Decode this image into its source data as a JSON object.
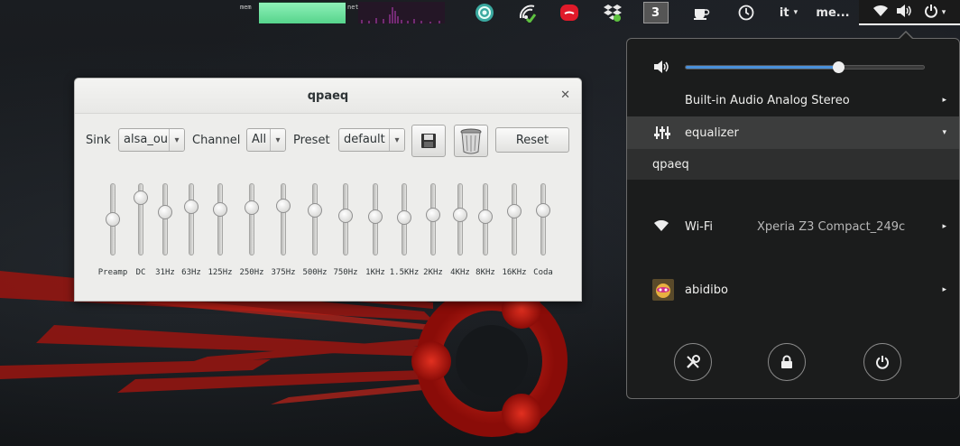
{
  "topbar": {
    "mem_label": "mem",
    "mem_fill": 0.95,
    "net_label": "net",
    "workspace_number": "3",
    "language": "it",
    "language_arrow": "▾",
    "user_short": "me...",
    "power_arrow": "▾",
    "icons": [
      "sync-icon",
      "network-icon",
      "note-icon",
      "dropbox-icon",
      "workspace-icon",
      "coffee-icon",
      "clock-icon",
      "wifi-icon",
      "volume-icon",
      "power-icon"
    ]
  },
  "qpaeq": {
    "title": "qpaeq",
    "close": "✕",
    "sink_label": "Sink",
    "sink_value": "alsa_ou",
    "channel_label": "Channel",
    "channel_value": "All",
    "preset_label": "Preset",
    "preset_value": "default",
    "combo_arrow": "▾",
    "reset_label": "Reset",
    "sliders": [
      {
        "label": "Preamp",
        "level": 0.5
      },
      {
        "label": "DC",
        "level": 0.8
      },
      {
        "label": "31Hz",
        "level": 0.6
      },
      {
        "label": "63Hz",
        "level": 0.67
      },
      {
        "label": "125Hz",
        "level": 0.64
      },
      {
        "label": "250Hz",
        "level": 0.66
      },
      {
        "label": "375Hz",
        "level": 0.69
      },
      {
        "label": "500Hz",
        "level": 0.62
      },
      {
        "label": "750Hz",
        "level": 0.55
      },
      {
        "label": "1KHz",
        "level": 0.54
      },
      {
        "label": "1.5KHz",
        "level": 0.53
      },
      {
        "label": "2KHz",
        "level": 0.56
      },
      {
        "label": "4KHz",
        "level": 0.56
      },
      {
        "label": "8KHz",
        "level": 0.54
      },
      {
        "label": "16KHz",
        "level": 0.61
      },
      {
        "label": "Coda",
        "level": 0.63
      }
    ]
  },
  "sysmenu": {
    "volume_level": 0.64,
    "audio_device": "Built-in Audio Analog Stereo",
    "equalizer_label": "equalizer",
    "qpaeq_item": "qpaeq",
    "wifi_label": "Wi-Fi",
    "wifi_network": "Xperia Z3 Compact_249c",
    "user_label": "abidibo",
    "arrow_right": "▸",
    "arrow_down": "▾",
    "colors": {
      "accent": "#4a90d9",
      "menu_bg": "#1b1c1c",
      "selected_row": "#3c3d3d"
    }
  }
}
